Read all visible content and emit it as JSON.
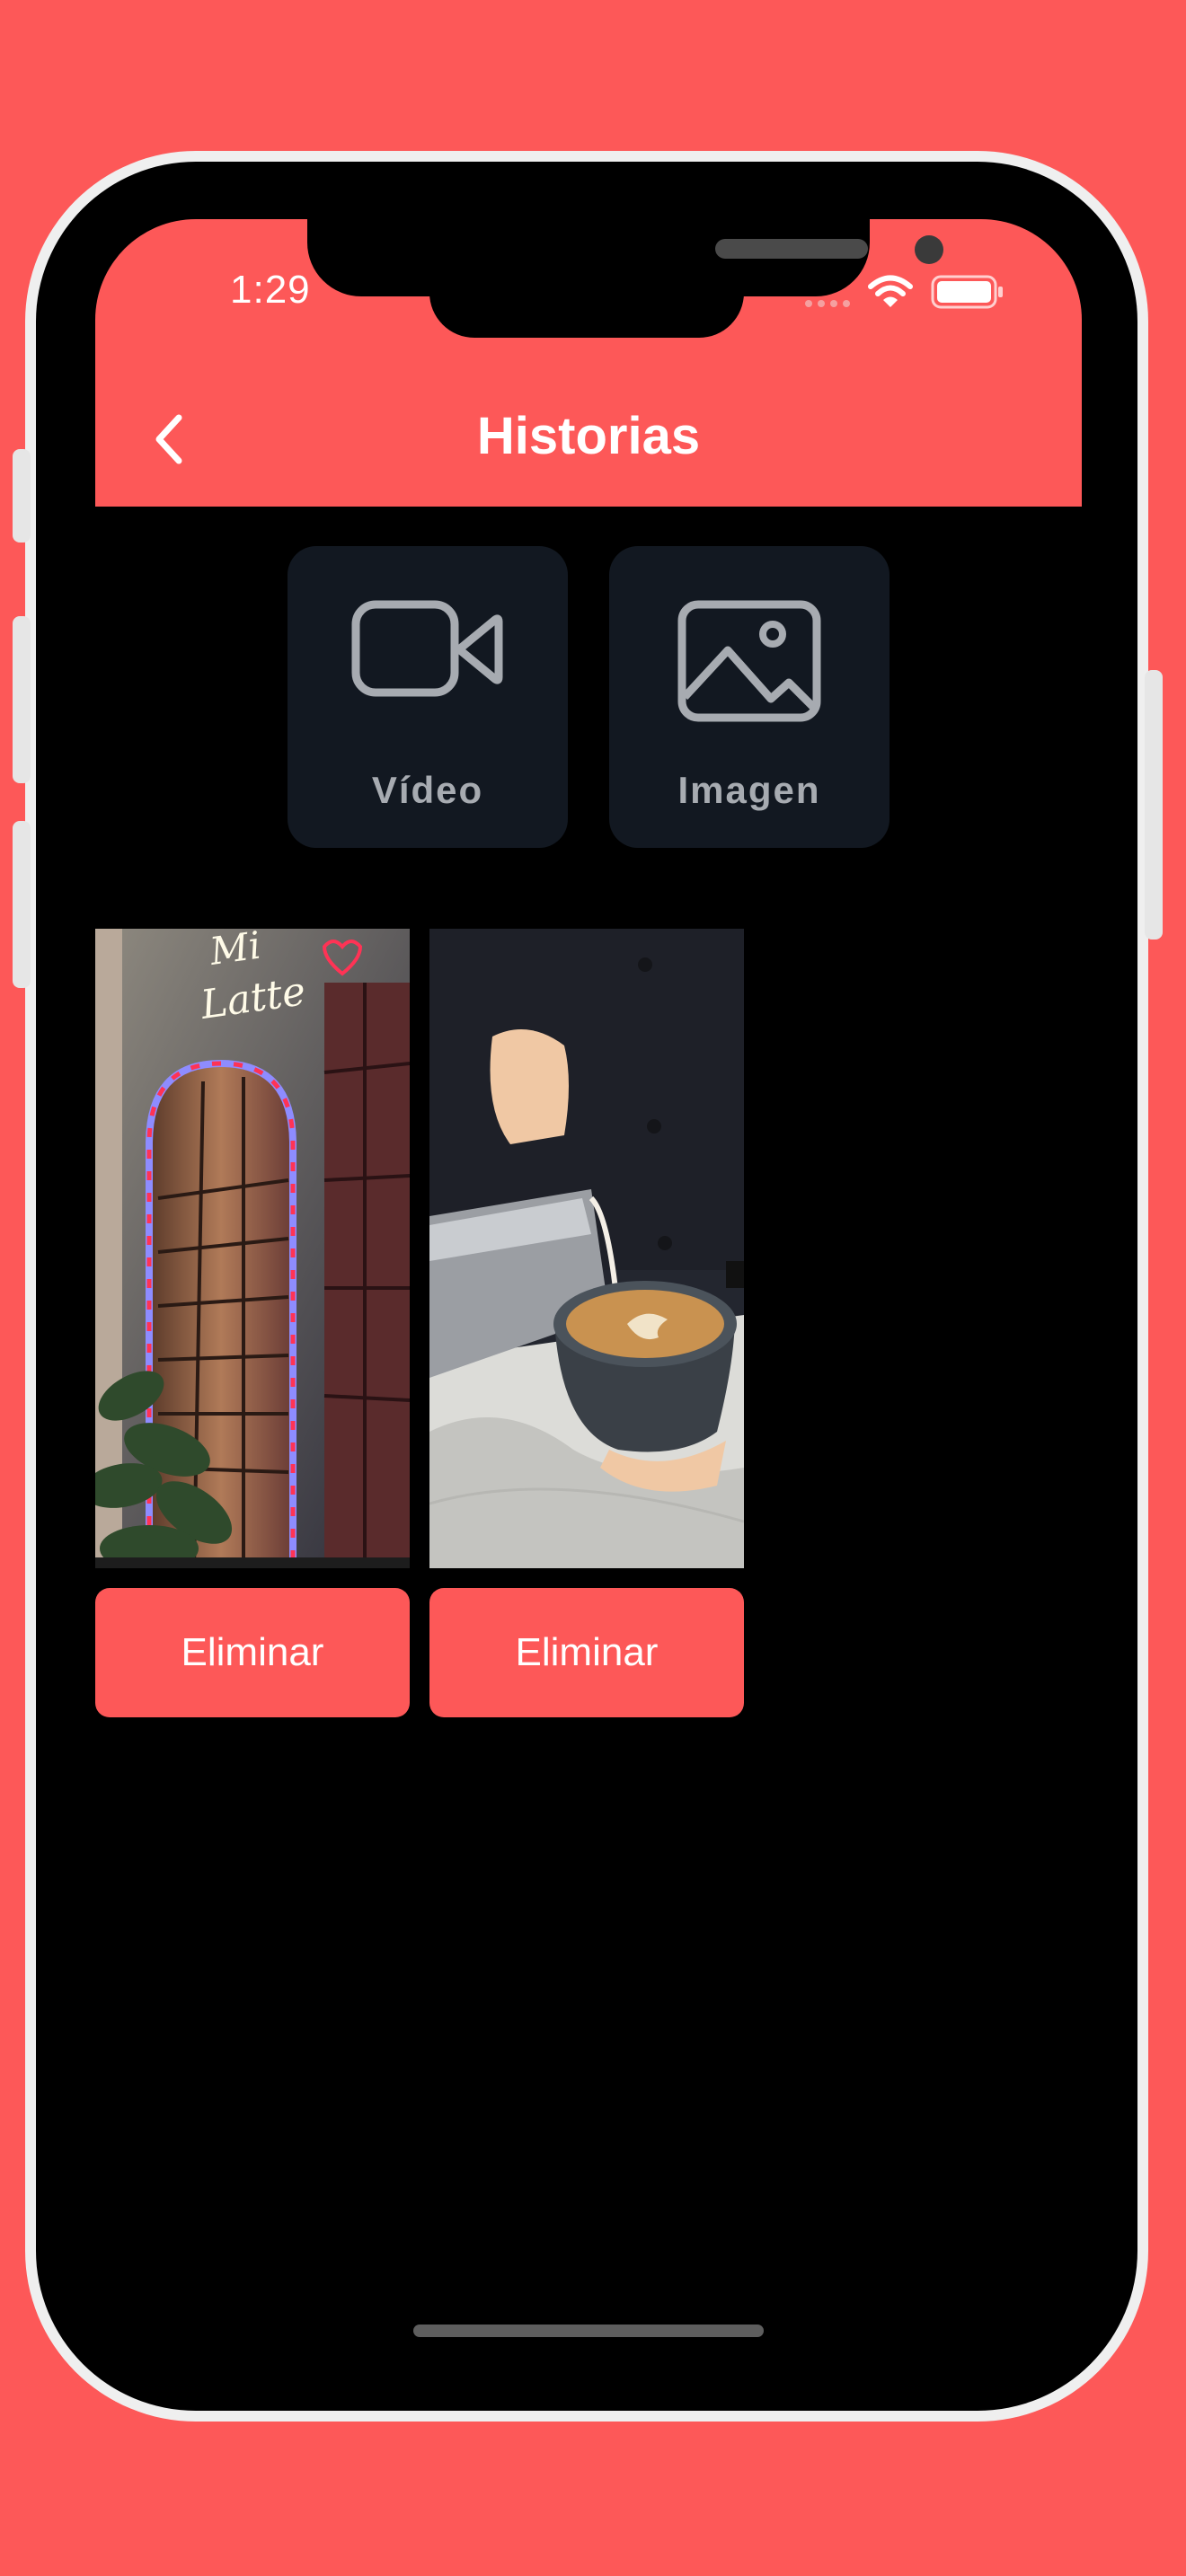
{
  "status_bar": {
    "time": "1:29"
  },
  "header": {
    "title": "Historias"
  },
  "media_options": [
    {
      "label": "Vídeo",
      "icon": "video-camera-icon"
    },
    {
      "label": "Imagen",
      "icon": "image-icon"
    }
  ],
  "stories": [
    {
      "delete_label": "Eliminar"
    },
    {
      "delete_label": "Eliminar"
    }
  ],
  "colors": {
    "accent": "#fd5858",
    "tile_background": "#121821",
    "tile_text": "#a7abb1",
    "screen_background": "#000000"
  }
}
